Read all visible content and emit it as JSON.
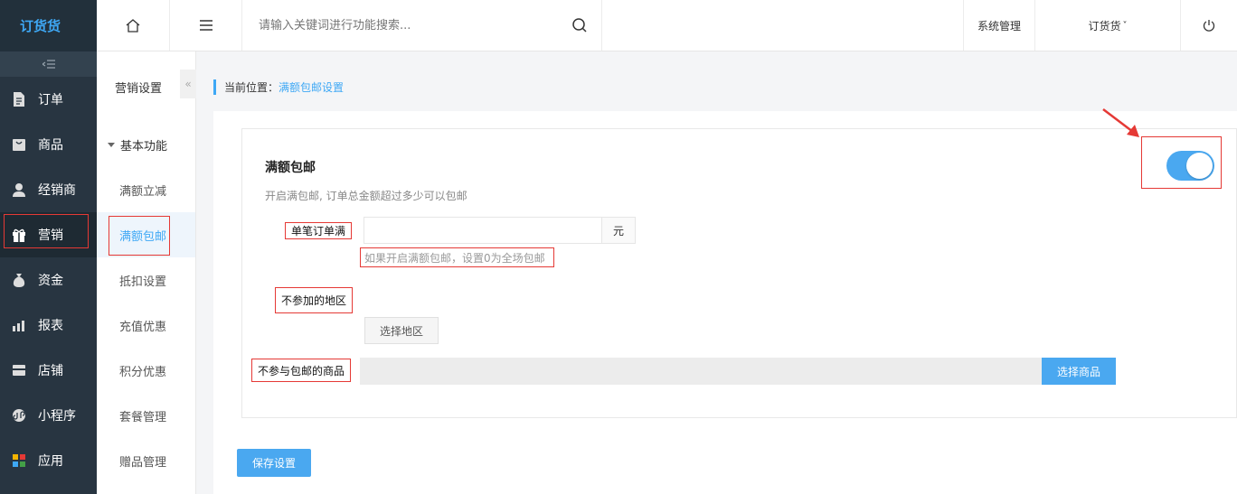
{
  "brand": {
    "logo": "订货货"
  },
  "nav": {
    "items": [
      {
        "label": "订单",
        "icon": "document-icon"
      },
      {
        "label": "商品",
        "icon": "bag-icon"
      },
      {
        "label": "经销商",
        "icon": "user-icon"
      },
      {
        "label": "营销",
        "icon": "gift-icon"
      },
      {
        "label": "资金",
        "icon": "money-bag-icon"
      },
      {
        "label": "报表",
        "icon": "bar-chart-icon"
      },
      {
        "label": "店铺",
        "icon": "store-icon"
      },
      {
        "label": "小程序",
        "icon": "mini-program-icon"
      },
      {
        "label": "应用",
        "icon": "apps-icon"
      }
    ],
    "active": "营销"
  },
  "subnav": {
    "title": "营销设置",
    "group": "基本功能",
    "items": [
      "满额立减",
      "满额包邮",
      "抵扣设置",
      "充值优惠",
      "积分优惠",
      "套餐管理",
      "赠品管理"
    ],
    "active": "满额包邮"
  },
  "topbar": {
    "search_placeholder": "请输入关键词进行功能搜索...",
    "system": "系统管理",
    "account": "订货货",
    "account_caret": "˅"
  },
  "breadcrumb": {
    "prefix": "当前位置：",
    "current": "满额包邮设置"
  },
  "panel": {
    "title": "满额包邮",
    "description": "开启满包邮, 订单总金额超过多少可以包邮",
    "enabled": true,
    "order_min_label": "单笔订单满",
    "order_min_value": "",
    "unit": "元",
    "hint": "如果开启满额包邮，设置0为全场包邮",
    "excluded_regions_label": "不参加的地区",
    "select_region_button": "选择地区",
    "excluded_goods_label": "不参与包邮的商品",
    "select_goods_button": "选择商品"
  },
  "save_button": "保存设置",
  "colors": {
    "accent": "#4aa8f0",
    "sidebar": "#283541",
    "annotation": "#e53935"
  }
}
